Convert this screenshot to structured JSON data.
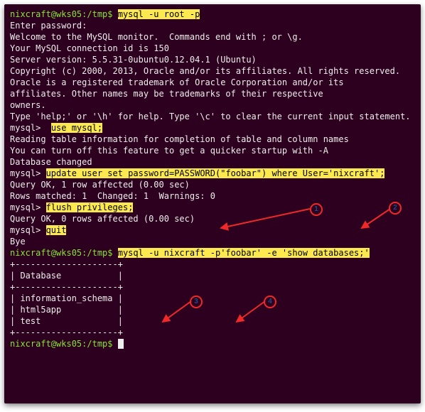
{
  "shell_prompt": "nixcraft@wks05:/tmp$ ",
  "mysql_prompt": "mysql> ",
  "lines": {
    "cmd1": "mysql -u root -p",
    "l1": "Enter password:",
    "l2": "Welcome to the MySQL monitor.  Commands end with ; or \\g.",
    "l3": "Your MySQL connection id is 150",
    "l4": "Server version: 5.5.31-0ubuntu0.12.04.1 (Ubuntu)",
    "l5": "",
    "l6": "Copyright (c) 2000, 2013, Oracle and/or its affiliates. All rights reserved.",
    "l7": "",
    "l8": "Oracle is a registered trademark of Oracle Corporation and/or its",
    "l9": "affiliates. Other names may be trademarks of their respective",
    "l10": "owners.",
    "l11": "",
    "l12": "Type 'help;' or '\\h' for help. Type '\\c' to clear the current input statement.",
    "l13": "",
    "cmd2_pre": " ",
    "cmd2": "use mysql;",
    "l14": "Reading table information for completion of table and column names",
    "l15": "You can turn off this feature to get a quicker startup with -A",
    "l16": "",
    "l17": "Database changed",
    "cmd3": "update user set password=PASSWORD(\"foobar\") where User='nixcraft';",
    "l18": "Query OK, 1 row affected (0.00 sec)",
    "l19": "Rows matched: 1  Changed: 1  Warnings: 0",
    "l20": "",
    "cmd4": "flush privileges;",
    "l21": "Query OK, 0 rows affected (0.00 sec)",
    "l22": "",
    "cmd5": "quit",
    "l23": "Bye",
    "cmd6": "mysql -u nixcraft -p'foobar' -e 'show databases;'",
    "t1": "+--------------------+",
    "t2": "| Database           |",
    "t3": "+--------------------+",
    "t4": "| information_schema |",
    "t5": "| html5app           |",
    "t6": "| test               |",
    "t7": "+--------------------+"
  },
  "annotations": {
    "a1": "1",
    "a2": "2",
    "a3": "3",
    "a4": "4"
  }
}
